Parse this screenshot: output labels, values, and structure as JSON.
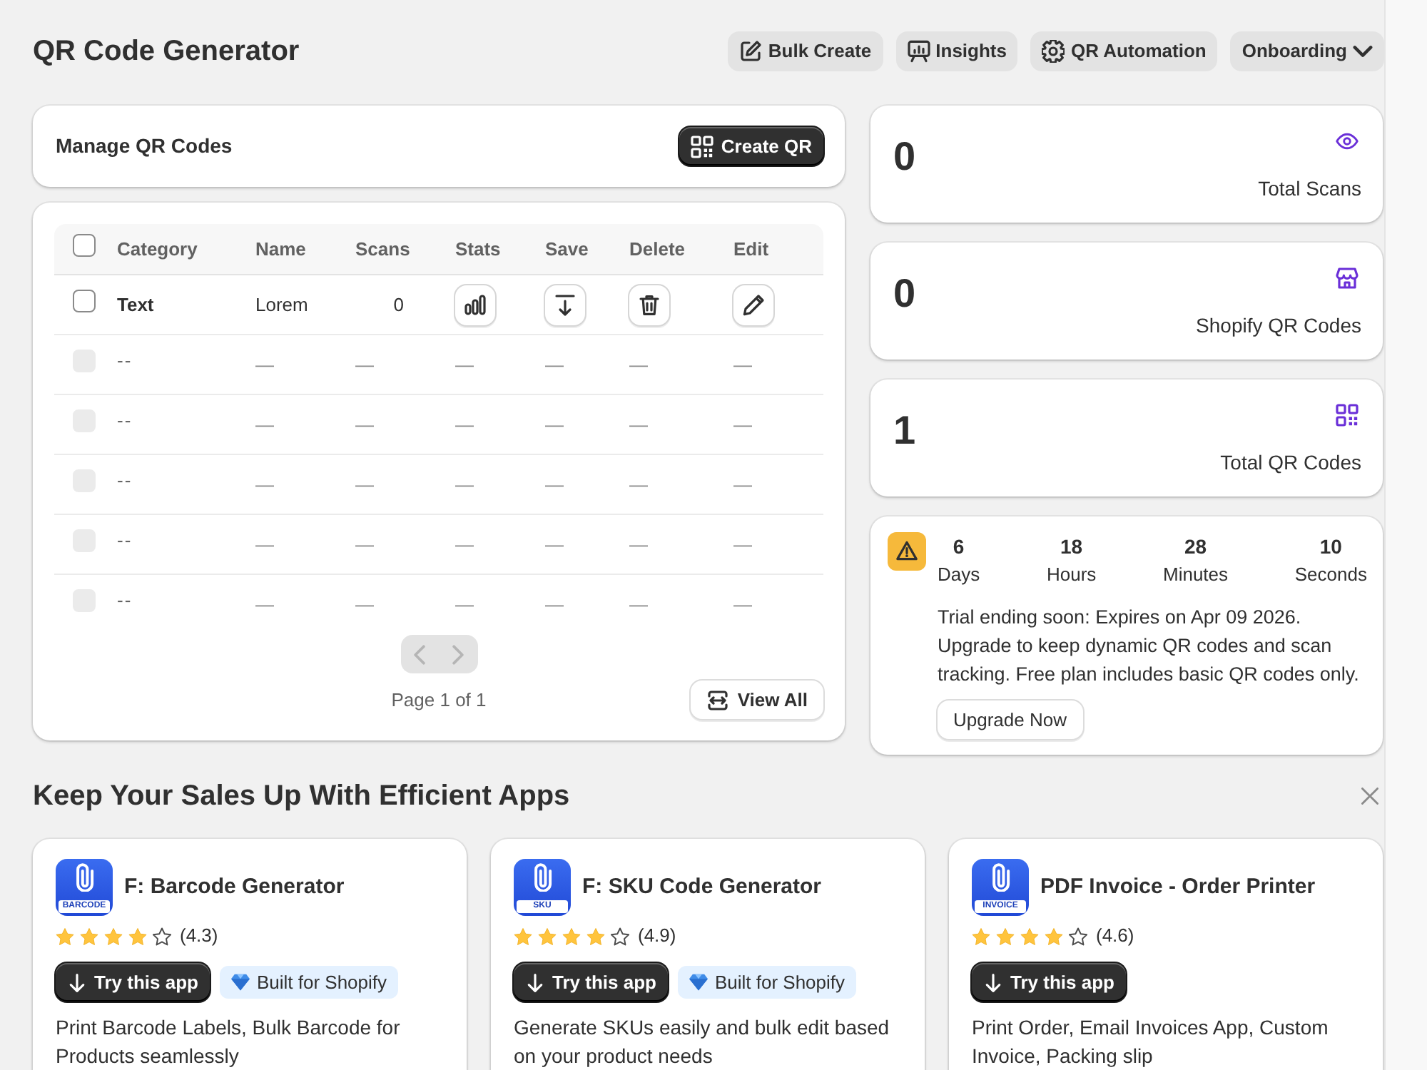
{
  "header": {
    "title": "QR Code Generator",
    "actions": [
      {
        "kind": "button",
        "label": "Bulk Create"
      },
      {
        "kind": "button",
        "label": "Insights"
      },
      {
        "kind": "button",
        "label": "QR Automation"
      },
      {
        "kind": "dropdown",
        "label": "Onboarding"
      }
    ]
  },
  "manage": {
    "title": "Manage QR Codes",
    "create_button": "Create QR"
  },
  "table": {
    "select_all_checked": false,
    "columns": [
      "Category",
      "Name",
      "Scans",
      "Stats",
      "Save",
      "Delete",
      "Edit"
    ],
    "rows": [
      {
        "kind": "item",
        "checked": false,
        "disabled": false,
        "category": "Text",
        "name": "Lorem",
        "scans": "0"
      },
      {
        "kind": "placeholder",
        "checked": false,
        "disabled": true,
        "category": "--",
        "cells": [
          "—",
          "—",
          "—",
          "—",
          "—",
          "—"
        ]
      },
      {
        "kind": "placeholder",
        "checked": false,
        "disabled": true,
        "category": "--",
        "cells": [
          "—",
          "—",
          "—",
          "—",
          "—",
          "—"
        ]
      },
      {
        "kind": "placeholder",
        "checked": false,
        "disabled": true,
        "category": "--",
        "cells": [
          "—",
          "—",
          "—",
          "—",
          "—",
          "—"
        ]
      },
      {
        "kind": "placeholder",
        "checked": false,
        "disabled": true,
        "category": "--",
        "cells": [
          "—",
          "—",
          "—",
          "—",
          "—",
          "—"
        ]
      },
      {
        "kind": "placeholder",
        "checked": false,
        "disabled": true,
        "category": "--",
        "cells": [
          "—",
          "—",
          "—",
          "—",
          "—",
          "—"
        ]
      }
    ],
    "pagination": {
      "disabled": true,
      "page_label": "Page 1 of 1"
    },
    "view_all": "View All"
  },
  "stats": [
    {
      "value": "0",
      "label": "Total Scans"
    },
    {
      "value": "0",
      "label": "Shopify QR Codes"
    },
    {
      "value": "1",
      "label": "Total QR Codes"
    }
  ],
  "trial": {
    "countdown": [
      {
        "value": "6",
        "unit": "Days"
      },
      {
        "value": "18",
        "unit": "Hours"
      },
      {
        "value": "28",
        "unit": "Minutes"
      },
      {
        "value": "10",
        "unit": "Seconds"
      }
    ],
    "message": "Trial ending soon: Expires on Apr 09 2026. Upgrade to keep dynamic QR codes and scan tracking. Free plan includes basic QR codes only.",
    "button": "Upgrade Now"
  },
  "apps": {
    "title": "Keep Your Sales Up With Efficient Apps",
    "items": [
      {
        "name": "F: Barcode Generator",
        "icon_label": "BARCODE",
        "stars": 4,
        "rating": "(4.3)",
        "button": "Try this app",
        "badge": "Built for Shopify",
        "description": "Print Barcode Labels, Bulk Barcode for Products seamlessly"
      },
      {
        "name": "F: SKU Code Generator",
        "icon_label": "SKU",
        "stars": 4,
        "rating": "(4.9)",
        "button": "Try this app",
        "badge": "Built for Shopify",
        "description": "Generate SKUs easily and bulk edit based on your product needs"
      },
      {
        "name": "PDF Invoice - Order Printer",
        "icon_label": "INVOICE",
        "stars": 4,
        "rating": "(4.6)",
        "button": "Try this app",
        "description": "Print Order, Email Invoices App, Custom Invoice, Packing slip"
      }
    ]
  }
}
